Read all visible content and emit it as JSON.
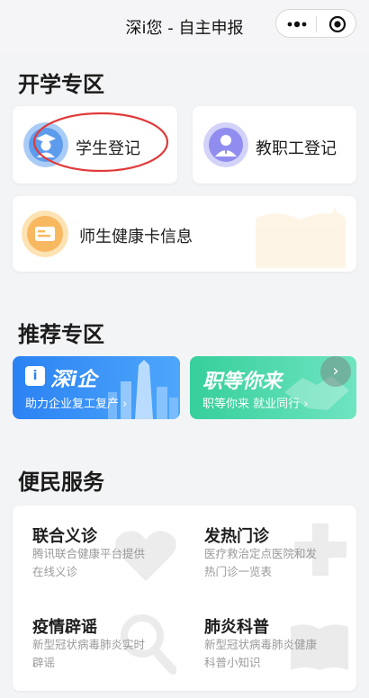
{
  "nav": {
    "title": "深i您 - 自主申报",
    "more_icon": "more-dots-icon",
    "close_icon": "target-icon"
  },
  "school": {
    "section_title": "开学专区",
    "student": {
      "label": "学生登记",
      "icon": "student-avatar-icon",
      "highlight_color": "#e03a3a"
    },
    "staff": {
      "label": "教职工登记",
      "icon": "teacher-avatar-icon"
    },
    "health": {
      "label": "师生健康卡信息",
      "icon": "id-card-icon"
    }
  },
  "recommend": {
    "section_title": "推荐专区",
    "left": {
      "title": "深i企",
      "subtitle": "助力企业复工复产 ›",
      "color": "#2f8cf5"
    },
    "right": {
      "title": "职等你来",
      "subtitle": "职等你来 就业同行 ›",
      "color": "#3fd5a4"
    }
  },
  "services": {
    "section_title": "便民服务",
    "items": [
      {
        "title": "联合义诊",
        "desc": "腾讯联合健康平台提供在线义诊",
        "icon": "heart-pulse-icon"
      },
      {
        "title": "发热门诊",
        "desc": "医疗救治定点医院和发热门诊一览表",
        "icon": "medical-cross-icon"
      },
      {
        "title": "疫情辟谣",
        "desc": "新型冠状病毒肺炎实时辟谣",
        "icon": "magnifier-icon"
      },
      {
        "title": "肺炎科普",
        "desc": "新型冠状病毒肺炎健康科普小知识",
        "icon": "book-icon"
      }
    ]
  }
}
